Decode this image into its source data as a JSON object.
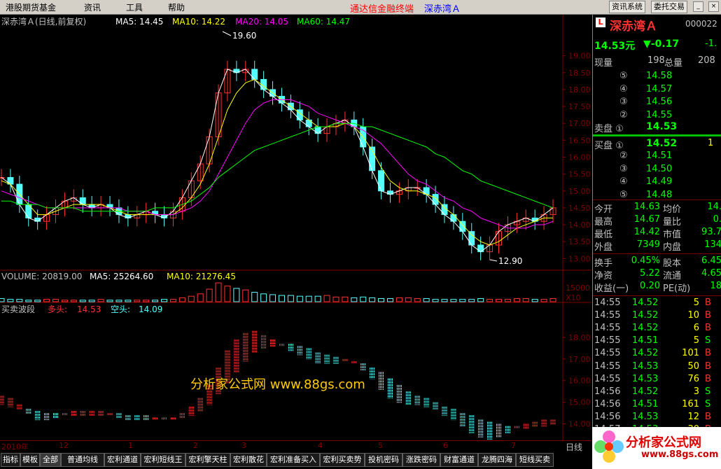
{
  "menu": {
    "items": [
      "港股期货基金",
      "资讯",
      "工具",
      "帮助"
    ],
    "center_title": "通达信金融终端",
    "stock_title": "深赤湾Ａ",
    "buttons": [
      "资讯系统",
      "委托交易"
    ]
  },
  "chart_header": {
    "name": "深赤湾Ａ(日线,前复权)",
    "ma5": "MA5: 14.45",
    "ma10": "MA10: 14.22",
    "ma20": "MA20: 14.05",
    "ma60": "MA60: 14.47"
  },
  "colors": {
    "ma5": "#ffffff",
    "ma10": "#ffff00",
    "ma20": "#ff00ff",
    "ma60": "#00ff00",
    "up": "#ff3232",
    "down": "#54ffff",
    "axis": "#800000"
  },
  "annotations": {
    "high": "19.60",
    "low": "12.90"
  },
  "volume_header": {
    "volume": "VOLUME: 20819.00",
    "ma5": "MA5: 25264.60",
    "ma10": "MA10: 21276.45",
    "axis_label": "15000",
    "unit": "X10"
  },
  "indicator_header": {
    "name": "买卖波段",
    "bull_label": "多头:",
    "bull_value": "14.53",
    "bear_label": "空头:",
    "bear_value": "14.09"
  },
  "watermark": "分析家公式网 www.88gs.com",
  "chart_data": [
    {
      "type": "line",
      "yaxis_ticks": [
        "19.00",
        "18.50",
        "18.00",
        "17.50",
        "17.00",
        "16.50",
        "16.00",
        "15.50",
        "15.00",
        "14.50",
        "14.00",
        "13.50",
        "13.00"
      ],
      "ylim": [
        12.8,
        19.8
      ],
      "x_dates": [
        "2010年",
        "12",
        "1",
        "2",
        "3",
        "4",
        "5",
        "6",
        "7"
      ],
      "series": [
        {
          "name": "MA5",
          "values": [
            15.4,
            15.2,
            14.6,
            14.2,
            14.1,
            14.3,
            14.5,
            14.7,
            14.8,
            14.6,
            14.5,
            14.6,
            14.5,
            14.3,
            14.2,
            14.3,
            14.4,
            14.3,
            14.2,
            14.4,
            14.8,
            15.3,
            15.8,
            16.6,
            17.9,
            18.6,
            18.5,
            18.6,
            18.3,
            18.0,
            17.8,
            17.6,
            17.4,
            17.1,
            16.9,
            16.7,
            16.9,
            17.0,
            17.1,
            16.9,
            16.3,
            15.6,
            15.0,
            14.9,
            15.0,
            15.1,
            15.1,
            14.9,
            14.6,
            14.3,
            14.1,
            13.8,
            13.4,
            13.2,
            13.4,
            13.8,
            14.0,
            14.1,
            14.2,
            14.1,
            14.3,
            14.5
          ]
        },
        {
          "name": "MA10",
          "values": [
            15.3,
            15.2,
            14.9,
            14.6,
            14.3,
            14.3,
            14.4,
            14.5,
            14.6,
            14.6,
            14.6,
            14.6,
            14.5,
            14.4,
            14.3,
            14.3,
            14.3,
            14.3,
            14.3,
            14.3,
            14.5,
            14.8,
            15.2,
            15.8,
            16.6,
            17.4,
            17.9,
            18.2,
            18.3,
            18.1,
            17.9,
            17.7,
            17.5,
            17.3,
            17.1,
            16.9,
            16.9,
            16.9,
            17.0,
            16.9,
            16.6,
            16.2,
            15.7,
            15.3,
            15.1,
            15.0,
            15.0,
            14.9,
            14.8,
            14.5,
            14.3,
            14.0,
            13.7,
            13.5,
            13.4,
            13.5,
            13.7,
            13.9,
            14.0,
            14.1,
            14.2,
            14.2
          ]
        },
        {
          "name": "MA20",
          "values": [
            15.0,
            14.9,
            14.8,
            14.7,
            14.6,
            14.5,
            14.5,
            14.5,
            14.5,
            14.5,
            14.5,
            14.5,
            14.5,
            14.5,
            14.4,
            14.4,
            14.4,
            14.3,
            14.3,
            14.3,
            14.4,
            14.5,
            14.7,
            15.0,
            15.5,
            16.0,
            16.5,
            17.0,
            17.4,
            17.6,
            17.7,
            17.7,
            17.7,
            17.6,
            17.5,
            17.3,
            17.2,
            17.1,
            17.0,
            16.9,
            16.8,
            16.6,
            16.4,
            16.1,
            15.8,
            15.5,
            15.3,
            15.2,
            15.0,
            14.8,
            14.7,
            14.5,
            14.4,
            14.2,
            14.1,
            14.0,
            13.9,
            13.9,
            13.9,
            14.0,
            14.0,
            14.1
          ]
        },
        {
          "name": "MA60",
          "values": [
            14.7,
            14.7,
            14.6,
            14.6,
            14.6,
            14.5,
            14.5,
            14.5,
            14.5,
            14.4,
            14.4,
            14.4,
            14.4,
            14.4,
            14.4,
            14.4,
            14.4,
            14.5,
            14.5,
            14.5,
            14.6,
            14.7,
            14.9,
            15.1,
            15.4,
            15.6,
            15.8,
            16.0,
            16.2,
            16.3,
            16.4,
            16.5,
            16.6,
            16.7,
            16.8,
            16.9,
            16.9,
            17.0,
            17.0,
            17.0,
            16.9,
            16.9,
            16.8,
            16.7,
            16.6,
            16.5,
            16.4,
            16.3,
            16.1,
            16.0,
            15.8,
            15.6,
            15.5,
            15.3,
            15.2,
            15.1,
            15.0,
            14.9,
            14.8,
            14.7,
            14.6,
            14.5
          ]
        }
      ]
    },
    {
      "type": "bar",
      "values": [
        0.4,
        0.3,
        0.3,
        0.2,
        0.2,
        0.3,
        0.3,
        0.2,
        0.2,
        0.2,
        0.2,
        0.3,
        0.2,
        0.2,
        0.2,
        0.2,
        0.2,
        0.2,
        0.3,
        0.3,
        0.5,
        0.7,
        1.0,
        1.6,
        2.4,
        2.0,
        1.7,
        1.5,
        1.2,
        1.0,
        0.9,
        0.8,
        0.8,
        0.7,
        0.7,
        0.7,
        0.8,
        0.6,
        0.6,
        0.5,
        0.6,
        0.5,
        0.4,
        0.4,
        0.5,
        0.5,
        0.4,
        0.4,
        0.3,
        0.3,
        0.3,
        0.3,
        0.3,
        0.4,
        0.3,
        0.3,
        0.3,
        0.4,
        0.4,
        0.3,
        0.3,
        0.4
      ]
    }
  ],
  "right_panel": {
    "stock_name": "深赤湾Ａ",
    "code": "000022",
    "price": "14.53元",
    "change": "▼-0.17",
    "change_pct": "-1.",
    "xianliang_label": "现量",
    "xianliang": "198",
    "zongliang_label": "总量",
    "zongliang": "208",
    "sell_levels": [
      {
        "label": "⑤",
        "price": "14.58"
      },
      {
        "label": "④",
        "price": "14.57"
      },
      {
        "label": "③",
        "price": "14.56"
      },
      {
        "label": "②",
        "price": "14.55"
      }
    ],
    "sell1_label": "卖盘 ①",
    "sell1_price": "14.53",
    "buy1_label": "买盘 ①",
    "buy1_price": "14.52",
    "buy1_vol": "1",
    "buy_levels": [
      {
        "label": "②",
        "price": "14.51"
      },
      {
        "label": "③",
        "price": "14.50"
      },
      {
        "label": "④",
        "price": "14.49"
      },
      {
        "label": "⑤",
        "price": "14.48"
      }
    ],
    "stats": [
      {
        "l1": "今开",
        "v1": "14.63",
        "l2": "均价",
        "v2": "14."
      },
      {
        "l1": "最高",
        "v1": "14.67",
        "l2": "量比",
        "v2": "0."
      },
      {
        "l1": "最低",
        "v1": "14.42",
        "l2": "市值",
        "v2": "93.7"
      },
      {
        "l1": "外盘",
        "v1": "7349",
        "l2": "内盘",
        "v2": "134"
      }
    ],
    "stats2": [
      {
        "l1": "换手",
        "v1": "0.45%",
        "l2": "股本",
        "v2": "6.45"
      },
      {
        "l1": "净资",
        "v1": "5.22",
        "l2": "流通",
        "v2": "4.65"
      },
      {
        "l1": "收益(一)",
        "v1": "0.20",
        "l2": "PE(动)",
        "v2": "18"
      }
    ],
    "ticks": [
      {
        "t": "14:55",
        "p": "14.52",
        "v": "5",
        "s": "B"
      },
      {
        "t": "14:55",
        "p": "14.52",
        "v": "10",
        "s": "B"
      },
      {
        "t": "14:55",
        "p": "14.52",
        "v": "6",
        "s": "B"
      },
      {
        "t": "14:55",
        "p": "14.51",
        "v": "5",
        "s": "S"
      },
      {
        "t": "14:55",
        "p": "14.52",
        "v": "101",
        "s": "B"
      },
      {
        "t": "14:55",
        "p": "14.53",
        "v": "50",
        "s": "B"
      },
      {
        "t": "14:55",
        "p": "14.53",
        "v": "76",
        "s": "B"
      },
      {
        "t": "14:56",
        "p": "14.52",
        "v": "3",
        "s": "S"
      },
      {
        "t": "14:56",
        "p": "14.51",
        "v": "161",
        "s": "S"
      },
      {
        "t": "14:56",
        "p": "14.53",
        "v": "12",
        "s": "B"
      },
      {
        "t": "14:57",
        "p": "14.53",
        "v": "30",
        "s": "B"
      }
    ]
  },
  "bottom_tabs": [
    "指标",
    "模板",
    "全部",
    "普通均线",
    "宏利通道",
    "宏利短线王",
    "宏利擎天柱",
    "宏利散花",
    "宏利准备买入",
    "宏利买卖势",
    "投机密码",
    "涨跌密码",
    "财富通道",
    "龙腾四海",
    "短线买卖"
  ],
  "date_right": "日线",
  "logo": {
    "text": "分析家公式网",
    "url": "www.88gs.com"
  }
}
